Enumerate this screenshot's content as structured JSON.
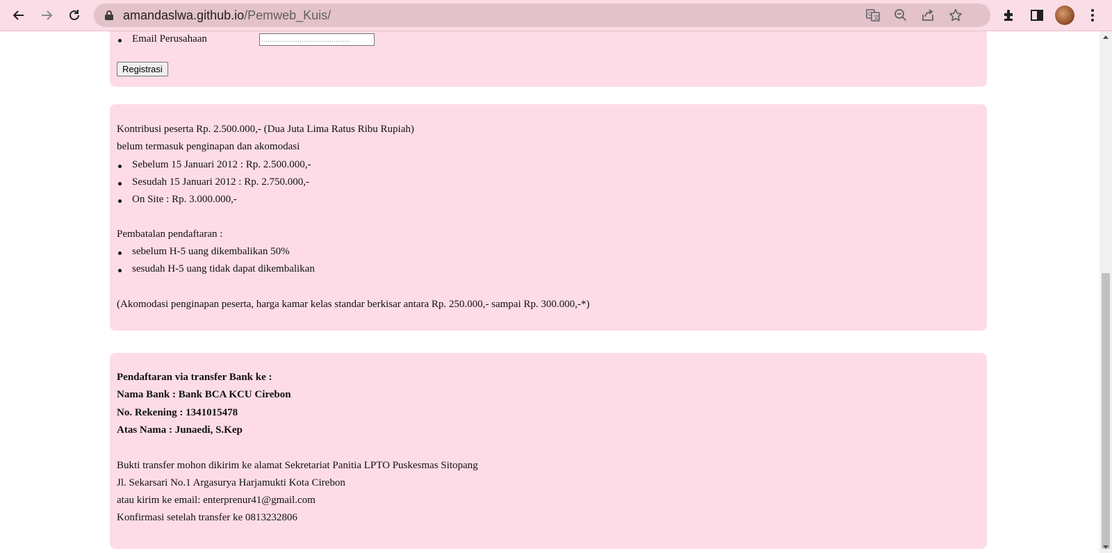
{
  "browser": {
    "url_host": "amandaslwa.github.io",
    "url_path": "/Pemweb_Kuis/",
    "icons": [
      "back-icon",
      "forward-icon",
      "reload-icon",
      "lock-icon",
      "translate-icon",
      "zoom-out-icon",
      "share-icon",
      "bookmark-star-icon",
      "extensions-icon",
      "side-panel-icon",
      "avatar",
      "menu-icon"
    ],
    "accent_color": "#fadde6"
  },
  "form": {
    "email_label": "Email Perusahaan",
    "email_placeholder": "..........................................",
    "register_button": "Registrasi"
  },
  "contribution": {
    "line1": "Kontribusi peserta Rp. 2.500.000,- (Dua Juta Lima Ratus Ribu Rupiah)",
    "line2": "belum termasuk penginapan dan akomodasi",
    "prices": [
      "Sebelum 15 Januari 2012 : Rp. 2.500.000,-",
      "Sesudah 15 Januari 2012 : Rp. 2.750.000,-",
      "On Site : Rp. 3.000.000,-"
    ],
    "cancel_title": "Pembatalan pendaftaran :",
    "cancel_items": [
      "sebelum H-5 uang dikembalikan 50%",
      "sesudah H-5 uang tidak dapat dikembalikan"
    ],
    "note": "(Akomodasi penginapan peserta, harga kamar kelas standar berkisar antara Rp. 250.000,- sampai Rp. 300.000,-*)"
  },
  "bank": {
    "title": "Pendaftaran via transfer Bank ke :",
    "bank_name": "Nama Bank : Bank BCA KCU Cirebon",
    "account_no": "No. Rekening : 1341015478",
    "account_name": "Atas Nama : Junaedi, S.Kep",
    "info1": "Bukti transfer mohon dikirim ke alamat Sekretariat Panitia LPTO Puskesmas Sitopang",
    "info2": "Jl. Sekarsari No.1 Argasurya Harjamukti Kota Cirebon",
    "info3": "atau kirim ke email: enterprenur41@gmail.com",
    "info4": "Konfirmasi setelah transfer ke 0813232806"
  },
  "colors": {
    "box_background": "#fddce8",
    "toolbar_background": "#fadde6"
  }
}
